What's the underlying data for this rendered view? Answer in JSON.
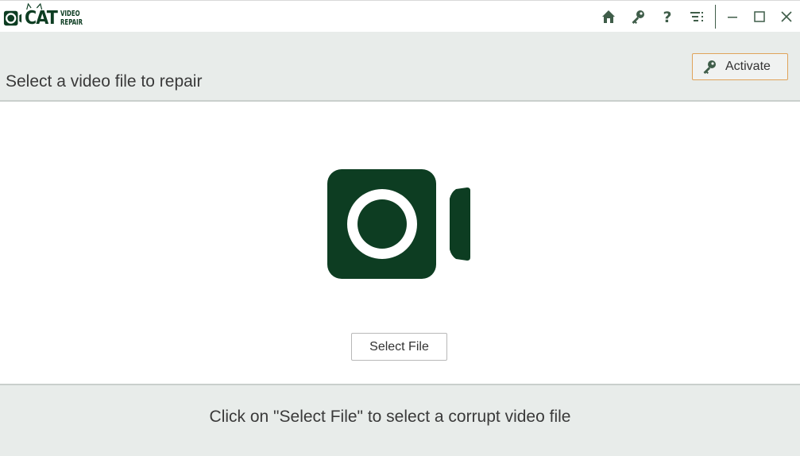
{
  "app": {
    "logo_word": "CAT",
    "logo_sub_1": "VIDEO",
    "logo_sub_2": "REPAIR",
    "brand_color": "#0d3d22",
    "accent_color": "#e0a35a"
  },
  "titlebar": {
    "icons": [
      "home-icon",
      "key-icon",
      "help-icon",
      "menu-icon",
      "minimize-icon",
      "maximize-icon",
      "close-icon"
    ]
  },
  "header": {
    "title": "Select a video file to repair",
    "activate_label": "Activate"
  },
  "main": {
    "select_file_label": "Select File"
  },
  "footer": {
    "hint": "Click on \"Select File\" to select a corrupt video file"
  }
}
